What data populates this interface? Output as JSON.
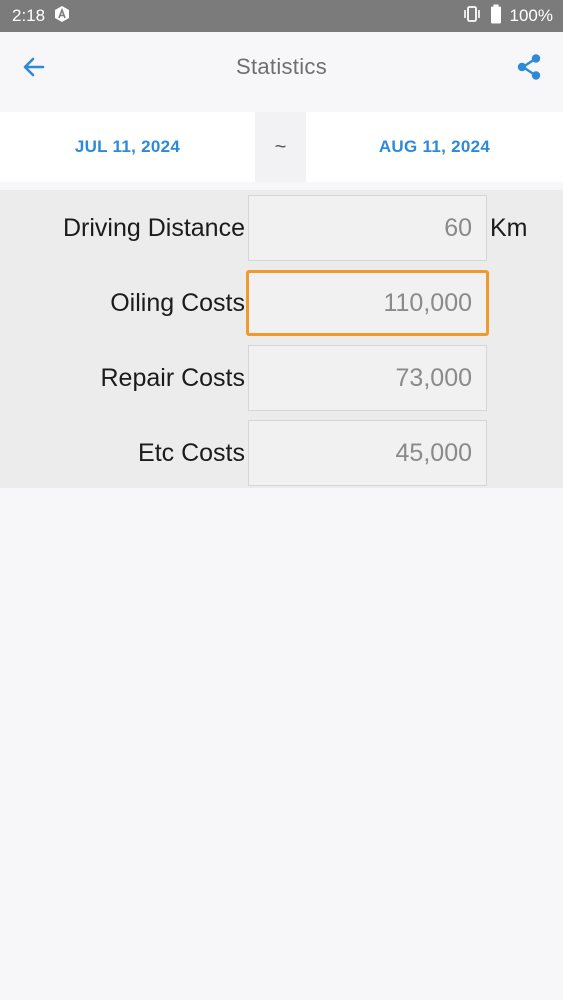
{
  "status_bar": {
    "time": "2:18",
    "battery": "100%"
  },
  "app_bar": {
    "title": "Statistics"
  },
  "date_range": {
    "start": "JUL 11, 2024",
    "separator": "~",
    "end": "AUG 11, 2024"
  },
  "stats": {
    "driving_distance": {
      "label": "Driving Distance",
      "value": "60",
      "unit": "Km"
    },
    "oiling_costs": {
      "label": "Oiling Costs",
      "value": "110,000"
    },
    "repair_costs": {
      "label": "Repair Costs",
      "value": "73,000"
    },
    "etc_costs": {
      "label": "Etc Costs",
      "value": "45,000"
    }
  },
  "colors": {
    "accent": "#2e8ad6",
    "focus": "#ef9a2a",
    "status_bar": "#7b7b7b"
  },
  "icons": {
    "back": "arrow-left-icon",
    "share": "share-icon",
    "notification": "android-a-icon",
    "vibrate": "vibrate-icon",
    "battery": "battery-icon"
  }
}
